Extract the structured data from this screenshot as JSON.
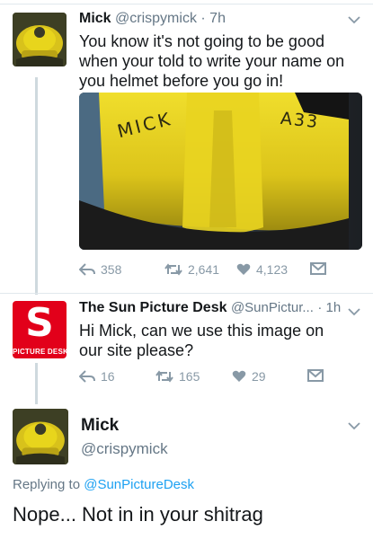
{
  "tweet1": {
    "name": "Mick",
    "handle": "@crispymick",
    "time": "· 7h",
    "text": "You know it's not going to be good when your told to write your name on you helmet before you go in!",
    "image_writing": {
      "left": "MICK",
      "right": "A33"
    },
    "actions": {
      "replies": "358",
      "retweets": "2,641",
      "likes": "4,123"
    }
  },
  "tweet2": {
    "name": "The Sun Picture Desk",
    "handle": "@SunPictur...",
    "time": "· 1h",
    "text": "Hi Mick, can we use this image on our site please?",
    "avatar_letter": "S",
    "avatar_label": "PICTURE DESK",
    "actions": {
      "replies": "16",
      "retweets": "165",
      "likes": "29"
    }
  },
  "tweet3": {
    "name": "Mick",
    "handle": "@crispymick",
    "replying_prefix": "Replying to",
    "replying_to": "@SunPictureDesk",
    "text": "Nope... Not in in your shitrag"
  },
  "colors": {
    "link": "#1da1f2",
    "muted": "#8899a6",
    "sun_red": "#e2001a",
    "helmet_yellow": "#e8d51c"
  }
}
